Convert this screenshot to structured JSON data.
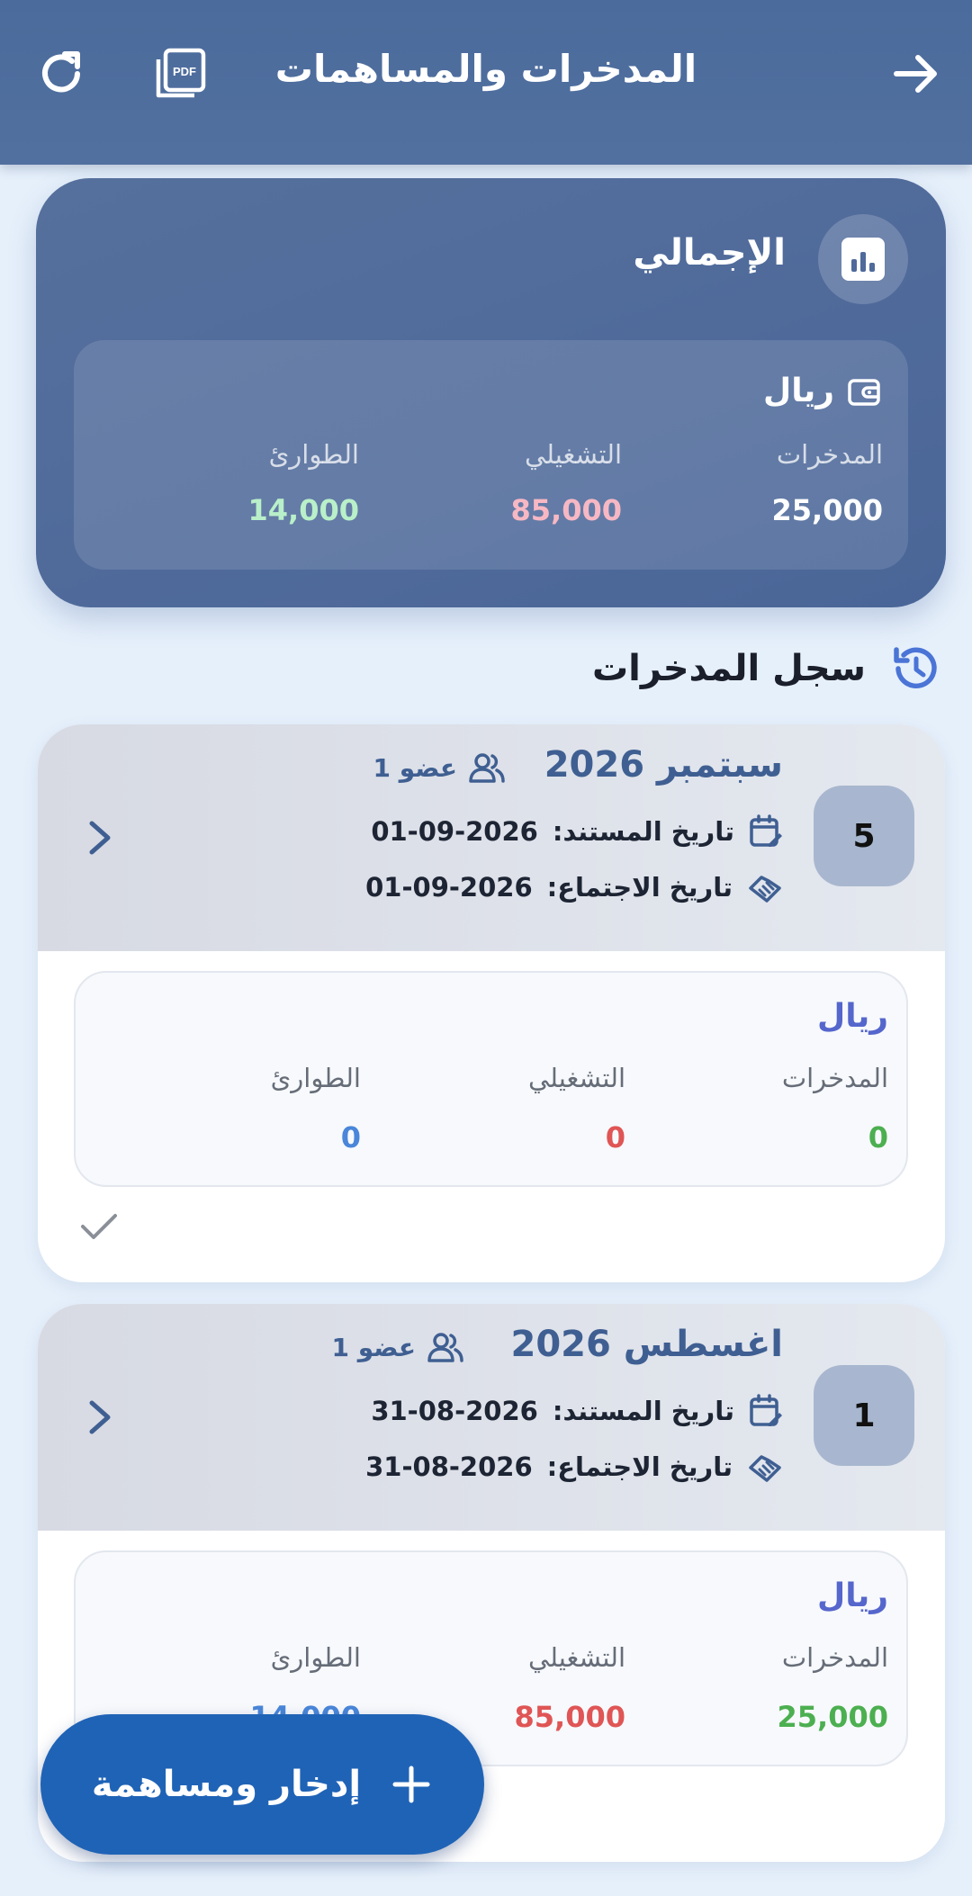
{
  "header": {
    "title": "المدخرات والمساهمات",
    "icons": [
      "arrow-right-icon",
      "pdf-icon",
      "refresh-icon"
    ]
  },
  "summary": {
    "title": "الإجمالي",
    "currency": "ريال",
    "labels": {
      "savings": "المدخرات",
      "operating": "التشغيلي",
      "emergency": "الطوارئ"
    },
    "values": {
      "savings": "25,000",
      "operating": "85,000",
      "emergency": "14,000"
    },
    "colors": {
      "savings": "#ffffff",
      "operating": "#f7b8c4",
      "emergency": "#b9f0c9"
    }
  },
  "history": {
    "title": "سجل المدخرات",
    "records": [
      {
        "number": "5",
        "month": "سبتمبر 2026",
        "members": "عضو 1",
        "document_date_label": "تاريخ المستند:",
        "document_date": "01-09-2026",
        "meeting_date_label": "تاريخ الاجتماع:",
        "meeting_date": "01-09-2026",
        "currency": "ريال",
        "labels": {
          "savings": "المدخرات",
          "operating": "التشغيلي",
          "emergency": "الطوارئ"
        },
        "values": {
          "savings": "0",
          "operating": "0",
          "emergency": "0"
        }
      },
      {
        "number": "1",
        "month": "اغسطس 2026",
        "members": "عضو 1",
        "document_date_label": "تاريخ المستند:",
        "document_date": "31-08-2026",
        "meeting_date_label": "تاريخ الاجتماع:",
        "meeting_date": "31-08-2026",
        "currency": "ريال",
        "labels": {
          "savings": "المدخرات",
          "operating": "التشغيلي",
          "emergency": "الطوارئ"
        },
        "values": {
          "savings": "25,000",
          "operating": "85,000",
          "emergency": "14,000"
        }
      }
    ]
  },
  "value_colors": {
    "savings": "#4caf50",
    "operating": "#e05555",
    "emergency": "#4a86d9"
  },
  "fab": {
    "label": "إدخار ومساهمة"
  }
}
